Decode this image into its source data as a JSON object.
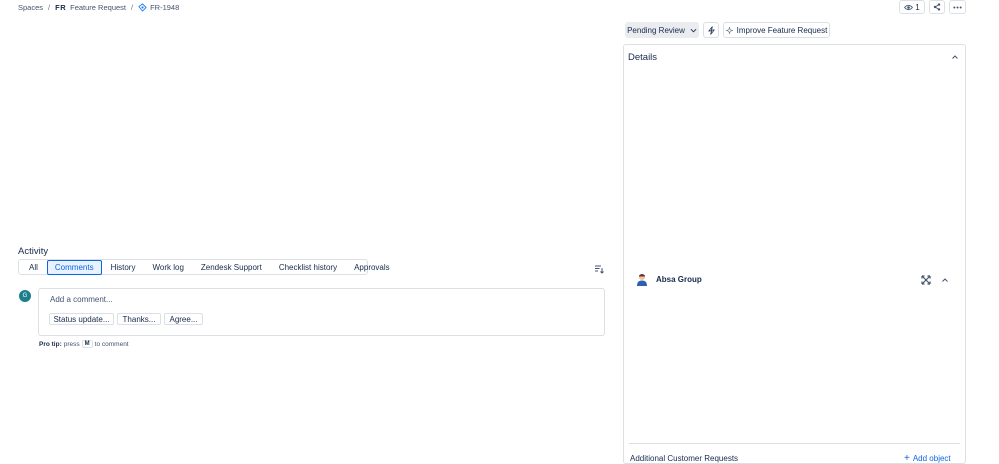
{
  "breadcrumb": {
    "spaces": "Spaces",
    "sep1": "/",
    "project_key": "FR",
    "project_name": "Feature Request",
    "sep2": "/",
    "issue_key": "FR-1948"
  },
  "toolbar": {
    "watchers_count": "1",
    "share_icon": "share-icon",
    "more_icon": "more-icon"
  },
  "status": {
    "label": "Pending Review",
    "improve_label": "Improve Feature Request"
  },
  "details": {
    "title": "Details",
    "object_label": "Absa Group",
    "additional_requests_label": "Additional Customer Requests",
    "add_object_label": "Add object"
  },
  "activity": {
    "title": "Activity",
    "tabs": [
      {
        "label": "All",
        "active": false
      },
      {
        "label": "Comments",
        "active": true
      },
      {
        "label": "History",
        "active": false
      },
      {
        "label": "Work log",
        "active": false
      },
      {
        "label": "Zendesk Support",
        "active": false
      },
      {
        "label": "Checklist history",
        "active": false
      },
      {
        "label": "Approvals",
        "active": false
      }
    ],
    "avatar_initial": "G",
    "comment_placeholder": "Add a comment...",
    "quick_replies": [
      "Status update...",
      "Thanks...",
      "Agree..."
    ],
    "pro_tip": {
      "bold": "Pro tip:",
      "press": "press",
      "key": "M",
      "suffix": "to comment"
    }
  },
  "colors": {
    "accent": "#0c66e4",
    "border": "#dcdfe4",
    "text": "#172b4d",
    "avatar_bg": "#1d7f8c"
  }
}
